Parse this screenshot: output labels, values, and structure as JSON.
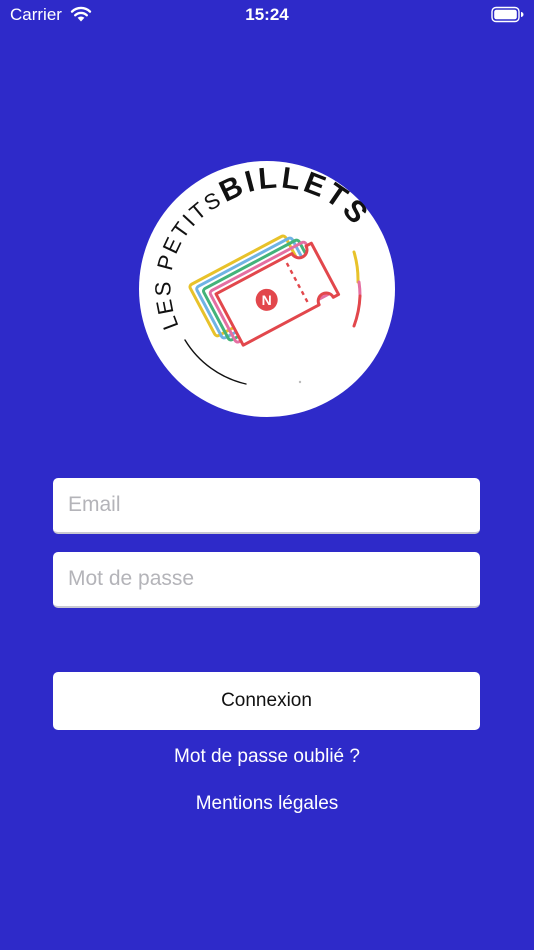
{
  "status_bar": {
    "carrier": "Carrier",
    "time": "15:24"
  },
  "logo": {
    "text_left": "LES PETITS",
    "text_right": "BILLETS",
    "ticket_badge": "N"
  },
  "form": {
    "email_placeholder": "Email",
    "password_placeholder": "Mot de passe",
    "login_label": "Connexion"
  },
  "links": {
    "forgot_password": "Mot de passe oublié ?",
    "legal": "Mentions légales"
  },
  "colors": {
    "background": "#2e2ac9",
    "ticket_red": "#e2474c",
    "ticket_yellow": "#e8c22a",
    "ticket_green": "#43b37a",
    "ticket_pink": "#e46fa2",
    "ticket_blue": "#6fb3e4"
  }
}
